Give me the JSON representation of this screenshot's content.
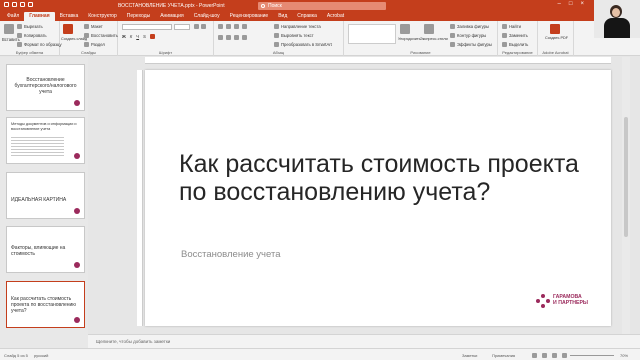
{
  "titlebar": {
    "doc_title": "ВОССТАНОВЛЕНИЕ УЧЕТА.pptx - PowerPoint",
    "search_placeholder": "Поиск"
  },
  "tabs": [
    "Файл",
    "Главная",
    "Вставка",
    "Конструктор",
    "Переходы",
    "Анимация",
    "Слайд-шоу",
    "Рецензирование",
    "Вид",
    "Справка",
    "Acrobat"
  ],
  "ribbon": {
    "clipboard": {
      "paste": "Вставить",
      "cut": "Вырезать",
      "copy": "Копировать",
      "format": "Формат по образцу",
      "label": "Буфер обмена"
    },
    "slides": {
      "new_slide": "Создать слайд",
      "layout": "Макет",
      "reset": "Восстановить",
      "section": "Раздел",
      "label": "Слайды"
    },
    "font": {
      "label": "Шрифт"
    },
    "paragraph": {
      "direction": "Направление текста",
      "align": "Выровнять текст",
      "smartart": "Преобразовать в SmartArt",
      "label": "Абзац"
    },
    "drawing": {
      "arrange": "Упорядочить",
      "styles": "Экспресс-стили",
      "fill": "Заливка фигуры",
      "outline": "Контур фигуры",
      "effects": "Эффекты фигуры",
      "label": "Рисование"
    },
    "editing": {
      "find": "Найти",
      "replace": "Заменить",
      "select": "Выделить",
      "label": "Редактирование"
    },
    "acrobat": {
      "create_pdf": "Создать PDF",
      "label": "Adobe Acrobat"
    }
  },
  "thumbnails": [
    {
      "num": "1",
      "title": "Восстановление бухгалтерского/налогового учета",
      "sub": ""
    },
    {
      "num": "2",
      "title": "Методы документов и информации и восстановление учета",
      "sub": ""
    },
    {
      "num": "3",
      "title": "ИДЕАЛЬНАЯ КАРТИНА",
      "sub": ""
    },
    {
      "num": "4",
      "title": "Факторы, влияющие на стоимость",
      "sub": ""
    },
    {
      "num": "5",
      "title": "Как рассчитать стоимость проекта по восстановлению учета?",
      "sub": ""
    }
  ],
  "slide": {
    "title": "Как рассчитать стоимость проекта по восстановлению учета?",
    "subtitle": "Восстановление учета",
    "logo_line1": "ГАРАМОВА",
    "logo_line2": "И ПАРТНЕРЫ"
  },
  "notes_placeholder": "Щелкните, чтобы добавить заметки",
  "status": {
    "slide_count": "Слайд 5 из 5",
    "language": "русский",
    "notes": "Заметки",
    "comments": "Примечания",
    "zoom": "70%"
  },
  "colors": {
    "accent": "#c43e1c",
    "brand": "#9b2a5c"
  }
}
